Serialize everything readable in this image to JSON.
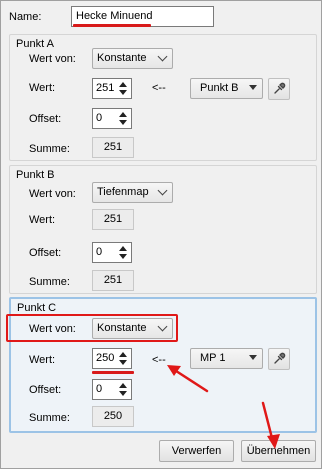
{
  "name": {
    "label": "Name:",
    "value": "Hecke Minuend"
  },
  "punkt_a": {
    "title": "Punkt A",
    "wert_von_label": "Wert von:",
    "wert_von_value": "Konstante",
    "wert_label": "Wert:",
    "wert_value": "251",
    "arrow_text": "<--",
    "source_value": "Punkt B",
    "offset_label": "Offset:",
    "offset_value": "0",
    "summe_label": "Summe:",
    "summe_value": "251"
  },
  "punkt_b": {
    "title": "Punkt B",
    "wert_von_label": "Wert von:",
    "wert_von_value": "Tiefenmap",
    "wert_label": "Wert:",
    "wert_value": "251",
    "offset_label": "Offset:",
    "offset_value": "0",
    "summe_label": "Summe:",
    "summe_value": "251"
  },
  "punkt_c": {
    "title": "Punkt C",
    "wert_von_label": "Wert von:",
    "wert_von_value": "Konstante",
    "wert_label": "Wert:",
    "wert_value": "250",
    "arrow_text": "<--",
    "source_value": "MP 1",
    "offset_label": "Offset:",
    "offset_value": "0",
    "summe_label": "Summe:",
    "summe_value": "250"
  },
  "buttons": {
    "discard": "Verwerfen",
    "apply": "Übernehmen"
  },
  "colors": {
    "annotation_red": "#e01818",
    "highlight_blue": "#9cc3e6"
  },
  "icons": [
    "eyedropper-icon",
    "chevron-down-icon",
    "spin-up-icon",
    "spin-down-icon"
  ]
}
